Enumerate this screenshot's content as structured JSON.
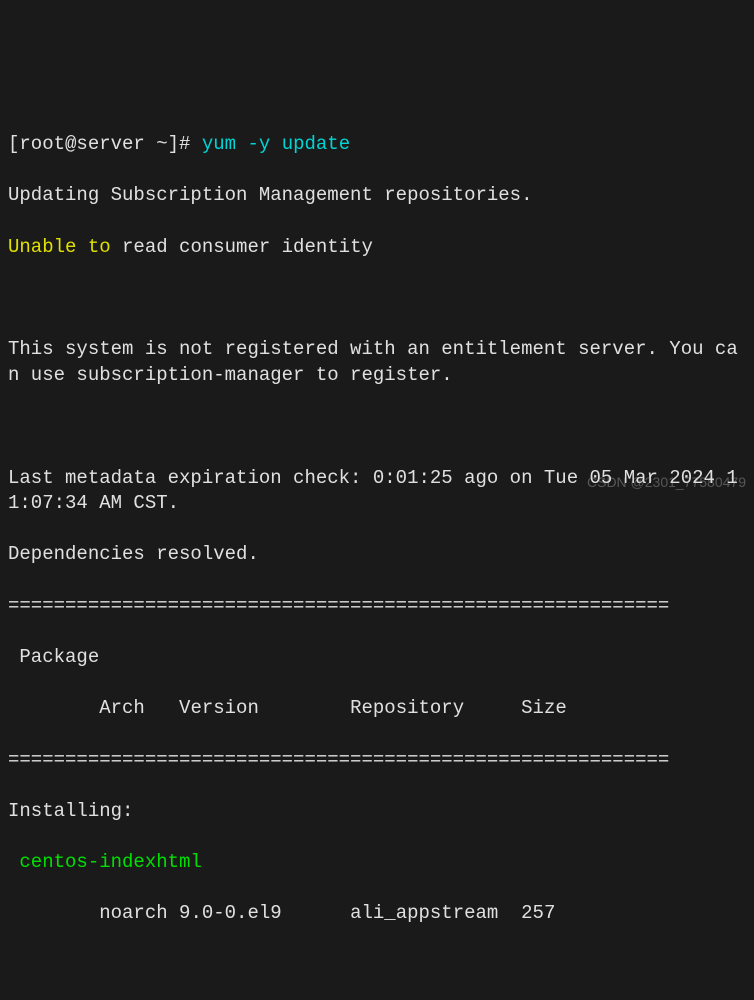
{
  "prompt": {
    "user_host": "[root@server ~]#",
    "command_bin": "yum",
    "command_flags": "-y",
    "command_action": "update"
  },
  "output": {
    "line_updating": "Updating Subscription Management repositories.",
    "warning_prefix": "Unable to",
    "warning_rest": "read consumer identity",
    "register_msg": "This system is not registered with an entitlement server. You can use subscription-manager to register.",
    "metadata_check": "Last metadata expiration check: 0:01:25 ago on Tue 05 Mar 2024 11:07:34 AM CST.",
    "deps_resolved": "Dependencies resolved.",
    "divider": "==========================================================",
    "header_package": " Package",
    "header_arch": "Arch",
    "header_version": "Version",
    "header_repo": "Repository",
    "header_size": "Size",
    "installing_label": "Installing:",
    "pkg1_name": "centos-indexhtml",
    "pkg1_arch": "noarch",
    "pkg1_version": "9.0-0.el9",
    "pkg1_repo": "ali_appstream",
    "pkg1_size": "257"
  },
  "watermark": "CSDN @2301_77580479"
}
